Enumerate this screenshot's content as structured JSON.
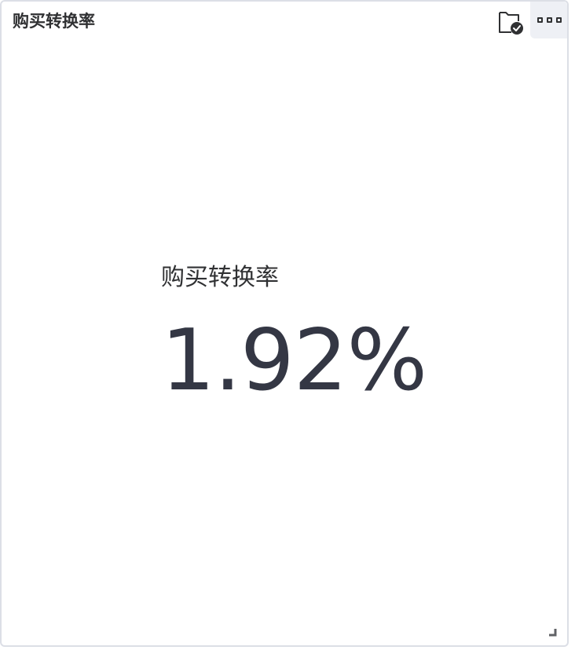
{
  "card": {
    "title": "购买转换率",
    "icons": {
      "folder": "folder-check-icon",
      "more": "more-icon",
      "resize": "resize-handle-icon"
    }
  },
  "metric": {
    "label": "购买转换率",
    "value": "1.92%"
  },
  "colors": {
    "text": "#303133",
    "value": "#343744",
    "border": "#dcdfe6",
    "menu_bg": "#eef0f5"
  }
}
